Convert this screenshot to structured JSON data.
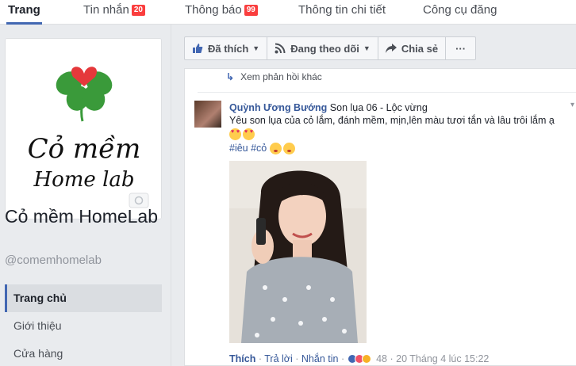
{
  "nav": {
    "tabs": [
      {
        "label": "Trang",
        "active": true
      },
      {
        "label": "Tin nhắn",
        "badge": "20"
      },
      {
        "label": "Thông báo",
        "badge": "99"
      },
      {
        "label": "Thông tin chi tiết"
      },
      {
        "label": "Công cụ đăng"
      }
    ]
  },
  "page": {
    "logo_name": "Cỏ mềm",
    "logo_sub": "Home lab",
    "name": "Cỏ mềm HomeLab",
    "handle": "@comemhomelab",
    "menu": [
      "Trang chủ",
      "Giới thiệu",
      "Cửa hàng"
    ]
  },
  "actions": {
    "liked": "Đã thích",
    "following": "Đang theo dõi",
    "share": "Chia sẻ",
    "more": "···"
  },
  "feed": {
    "more_replies": "Xem phản hồi khác",
    "comment": {
      "author": "Quỳnh Ương Bướng",
      "product": "Son lụa 06 - Lộc vừng",
      "text": "Yêu son lụa của cỏ lắm, đánh mềm, mịn,lên màu tươi tắn và lâu trôi lắm ạ",
      "hashtags": "#iêu #cỏ",
      "like": "Thích",
      "reply": "Trả lời",
      "message": "Nhắn tin",
      "reaction_count": "48",
      "timestamp": "20 Tháng 4 lúc 15:22",
      "separator": "·"
    }
  },
  "colors": {
    "accent": "#4267b2",
    "link": "#365899",
    "badge": "#fa3e3e",
    "logo_green": "#3a9a3a",
    "logo_heart": "#e5383b"
  }
}
